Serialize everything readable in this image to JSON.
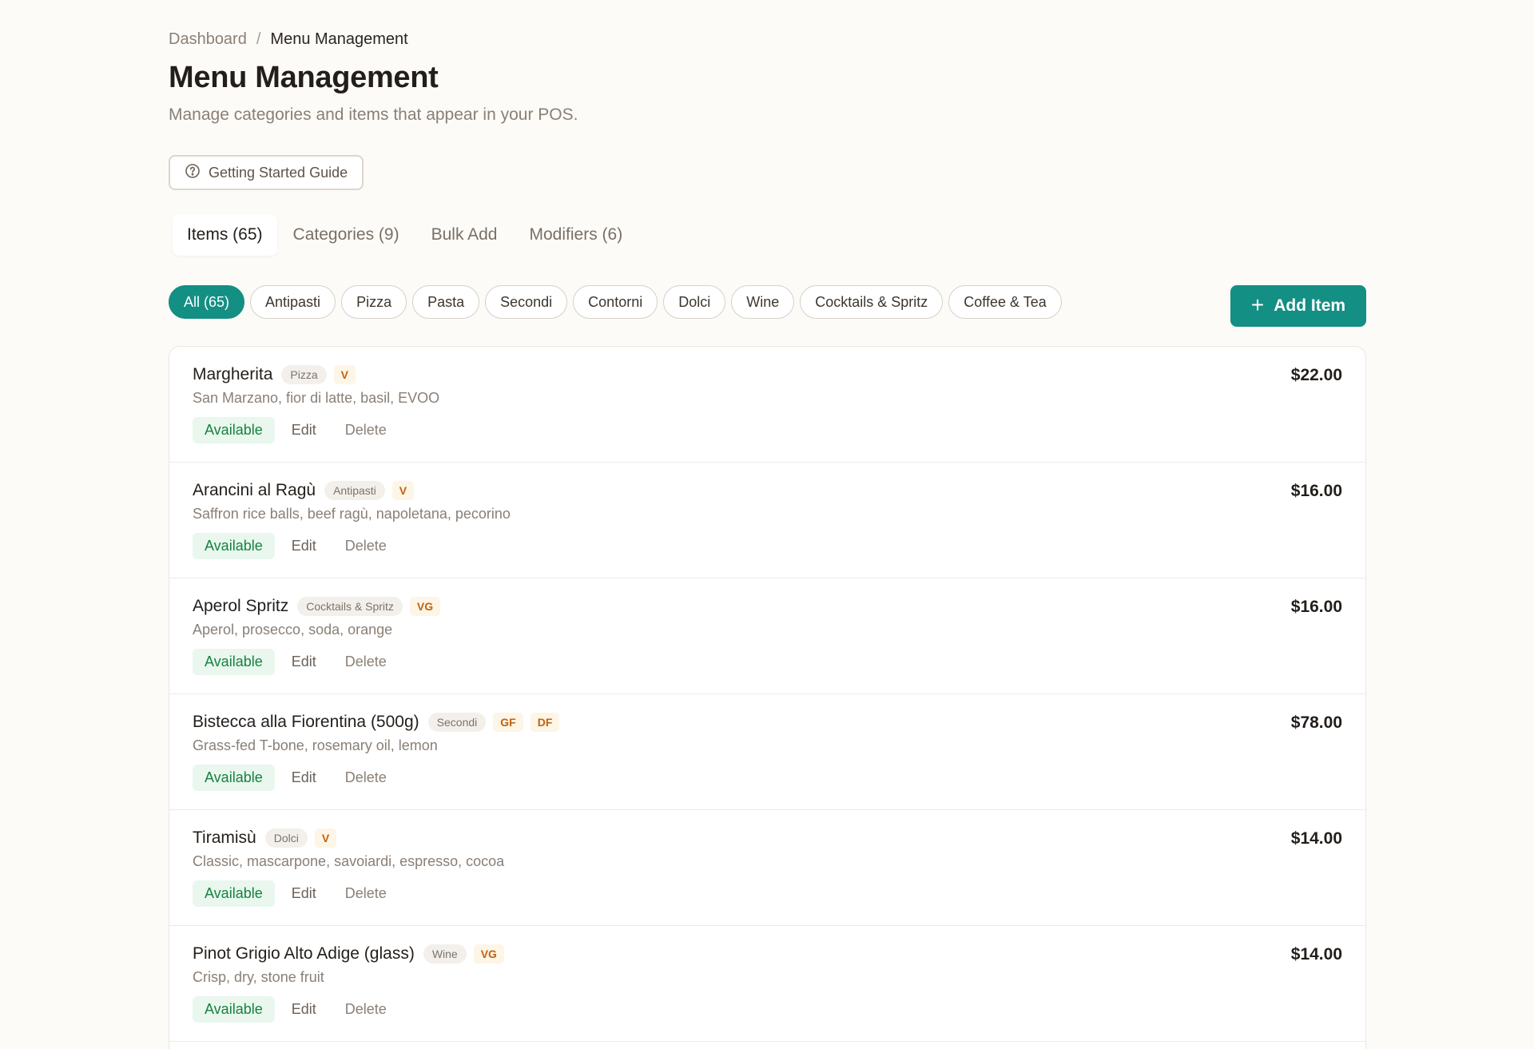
{
  "breadcrumb": {
    "parent": "Dashboard",
    "separator": "/",
    "current": "Menu Management"
  },
  "page": {
    "title": "Menu Management",
    "subtitle": "Manage categories and items that appear in your POS.",
    "guide_label": "Getting Started Guide"
  },
  "tabs": [
    {
      "label": "Items (65)",
      "active": true
    },
    {
      "label": "Categories (9)",
      "active": false
    },
    {
      "label": "Bulk Add",
      "active": false
    },
    {
      "label": "Modifiers (6)",
      "active": false
    }
  ],
  "filters": [
    {
      "label": "All (65)",
      "active": true
    },
    {
      "label": "Antipasti"
    },
    {
      "label": "Pizza"
    },
    {
      "label": "Pasta"
    },
    {
      "label": "Secondi"
    },
    {
      "label": "Contorni"
    },
    {
      "label": "Dolci"
    },
    {
      "label": "Wine"
    },
    {
      "label": "Cocktails & Spritz"
    },
    {
      "label": "Coffee & Tea"
    }
  ],
  "add_item_label": "Add Item",
  "items": [
    {
      "name": "Margherita",
      "category": "Pizza",
      "tags": [
        "V"
      ],
      "description": "San Marzano, fior di latte, basil, EVOO",
      "status": "Available",
      "price": "$22.00"
    },
    {
      "name": "Arancini al Ragù",
      "category": "Antipasti",
      "tags": [
        "V"
      ],
      "description": "Saffron rice balls, beef ragù, napoletana, pecorino",
      "status": "Available",
      "price": "$16.00"
    },
    {
      "name": "Aperol Spritz",
      "category": "Cocktails & Spritz",
      "tags": [
        "VG"
      ],
      "description": "Aperol, prosecco, soda, orange",
      "status": "Available",
      "price": "$16.00"
    },
    {
      "name": "Bistecca alla Fiorentina (500g)",
      "category": "Secondi",
      "tags": [
        "GF",
        "DF"
      ],
      "description": "Grass-fed T-bone, rosemary oil, lemon",
      "status": "Available",
      "price": "$78.00"
    },
    {
      "name": "Tiramisù",
      "category": "Dolci",
      "tags": [
        "V"
      ],
      "description": "Classic, mascarpone, savoiardi, espresso, cocoa",
      "status": "Available",
      "price": "$14.00"
    },
    {
      "name": "Pinot Grigio Alto Adige (glass)",
      "category": "Wine",
      "tags": [
        "VG"
      ],
      "description": "Crisp, dry, stone fruit",
      "status": "Available",
      "price": "$14.00"
    }
  ],
  "actions": {
    "edit": "Edit",
    "delete": "Delete"
  },
  "colors": {
    "accent": "#148f84",
    "available_bg": "#e9f7ee",
    "available_text": "#17823f",
    "diet_text": "#c2620f"
  }
}
